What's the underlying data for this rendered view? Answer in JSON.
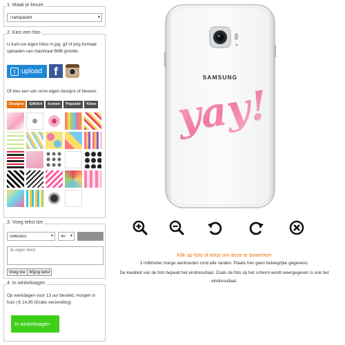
{
  "step1": {
    "legend": "1. Maak je keuze",
    "selected": "Transparant"
  },
  "step2": {
    "legend": "2. Kies een foto",
    "intro": "U kunt uw eigen fotos in jpg, gif of png formaat uploaden van maximaal 6MB grootte.",
    "upload_label": "upload",
    "facebook_label": "f",
    "designs_intro": "Of kies een van onze eigen designs of kleuren:",
    "tabs": [
      "Designs",
      "Gift/Art",
      "Iconen",
      "Populair",
      "Kleur"
    ]
  },
  "step3": {
    "legend": "3. Voeg tekst toe",
    "font_selected": "Delicious",
    "size_selected": "40",
    "text_placeholder": "Je eigen tekst",
    "add_label": "Voeg toe",
    "edit_label": "Wijzig tekst"
  },
  "step4": {
    "legend": "4. In winkelwagen",
    "info": "Op werkdagen voor 13 uur besteld, morgen in huis | € 14,95 (Gratis verzending)",
    "cart_label": "In winkelwagen"
  },
  "phone": {
    "brand": "SAMSUNG",
    "design_text": "yay!"
  },
  "controls": [
    "zoom-in",
    "zoom-out",
    "rotate-left",
    "rotate-right",
    "delete"
  ],
  "hints": {
    "edit": "Klik op foto of tekst om deze te bewerken",
    "margin": "3 millimeter marge aanhouden rond alle randen. Plaats hier geen belangrijke gegevens.",
    "quality": "De kwaliteit van de foto bepaalt het eindresultaat. Zoals de foto op het scherm wordt weergegeven is ook het eindresultaat."
  },
  "colors": {
    "accent": "#e8730c",
    "upload": "#1e88d6",
    "cart": "#3fcf1a",
    "hint": "#e8730c"
  }
}
